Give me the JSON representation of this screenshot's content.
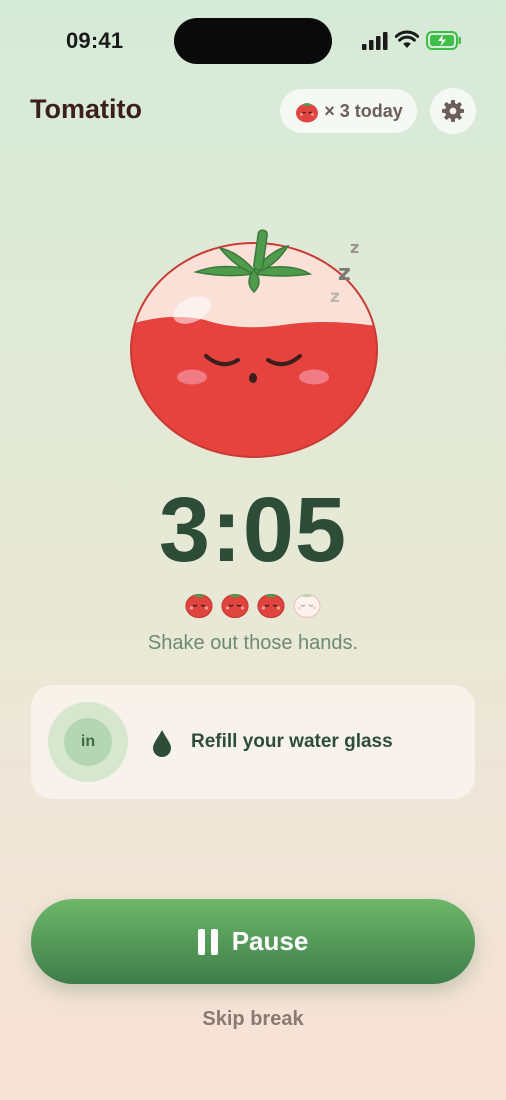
{
  "status_bar": {
    "time": "09:41"
  },
  "header": {
    "title": "Tomatito",
    "count_text": "× 3 today"
  },
  "timer": {
    "remaining": "3:05"
  },
  "session_progress": {
    "completed": 3,
    "total": 4
  },
  "caption": "Shake out those hands.",
  "tip_card": {
    "breath_phase": "in",
    "text": "Refill your water glass"
  },
  "actions": {
    "pause_label": "Pause",
    "skip_label": "Skip break"
  },
  "colors": {
    "accent_green": "#4e9a57",
    "tomato_red": "#e0443f",
    "text_dark": "#2e4d39"
  },
  "icons": [
    "signal-icon",
    "wifi-icon",
    "battery-icon",
    "tomato-icon",
    "gear-icon",
    "water-drop-icon",
    "pause-icon"
  ]
}
